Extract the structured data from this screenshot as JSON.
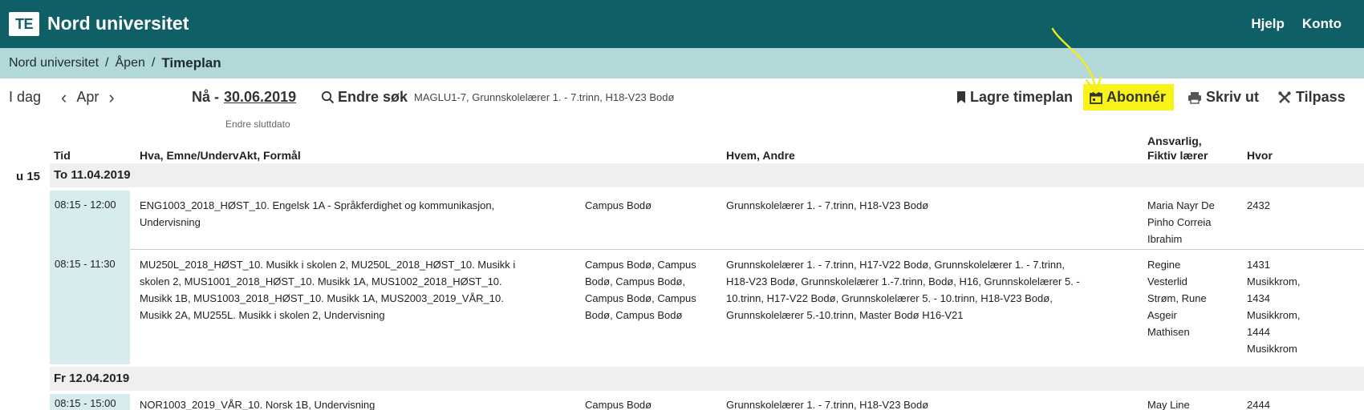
{
  "app": {
    "logo": "TE",
    "title": "Nord universitet",
    "links": [
      "Hjelp",
      "Konto"
    ]
  },
  "breadcrumb": {
    "items": [
      "Nord universitet",
      "Åpen"
    ],
    "separator": "/",
    "current": "Timeplan"
  },
  "toolbar": {
    "today": "I dag",
    "month": "Apr",
    "now_label": "Nå -",
    "end_date": "30.06.2019",
    "end_date_note": "Endre sluttdato",
    "search_label": "Endre søk",
    "search_query": "MAGLU1-7, Grunnskolelærer 1. - 7.trinn, H18-V23 Bodø",
    "actions": {
      "save": "Lagre timeplan",
      "subscribe": "Abonnér",
      "print": "Skriv ut",
      "customize": "Tilpass"
    }
  },
  "table": {
    "headers": {
      "time": "Tid",
      "what": "Hva, Emne/UndervAkt, Formål",
      "who": "Hvem, Andre",
      "responsible_1": "Ansvarlig,",
      "responsible_2": "Fiktiv lærer",
      "where": "Hvor"
    },
    "week": "u 15",
    "days": [
      {
        "label": "To 11.04.2019",
        "rows": [
          {
            "time": "08:15 - 12:00",
            "what": [
              "ENG1003_2018_HØST_10. Engelsk 1A - Språkferdighet og kommunikasjon,",
              "Undervisning"
            ],
            "campus": [
              "Campus Bodø"
            ],
            "who": [
              "Grunnskolelærer 1. - 7.trinn, H18-V23 Bodø"
            ],
            "responsible": [
              "Maria Nayr De",
              "Pinho Correia",
              "Ibrahim"
            ],
            "where": [
              "2432"
            ]
          },
          {
            "time": "08:15 - 11:30",
            "what": [
              "MU250L_2018_HØST_10. Musikk i skolen 2, MU250L_2018_HØST_10. Musikk i",
              "skolen 2, MUS1001_2018_HØST_10. Musikk 1A, MUS1002_2018_HØST_10.",
              "Musikk 1B, MUS1003_2018_HØST_10. Musikk 1A, MUS2003_2019_VÅR_10.",
              "Musikk 2A, MU255L. Musikk i skolen 2, Undervisning"
            ],
            "campus": [
              "Campus Bodø, Campus",
              "Bodø, Campus Bodø,",
              "Campus Bodø, Campus",
              "Bodø, Campus Bodø"
            ],
            "who": [
              "Grunnskolelærer 1. - 7.trinn, H17-V22 Bodø, Grunnskolelærer 1. - 7.trinn,",
              "H18-V23 Bodø, Grunnskolelærer 1.-7.trinn, Bodø, H16, Grunnskolelærer 5. -",
              "10.trinn, H17-V22 Bodø, Grunnskolelærer 5. - 10.trinn, H18-V23 Bodø,",
              "Grunnskolelærer 5.-10.trinn, Master Bodø H16-V21"
            ],
            "responsible": [
              "Regine",
              "Vesterlid",
              "Strøm, Rune",
              "Asgeir",
              "Mathisen"
            ],
            "where": [
              "1431",
              "Musikkrom,",
              "1434",
              "Musikkrom,",
              "1444",
              "Musikkrom"
            ]
          }
        ]
      },
      {
        "label": "Fr 12.04.2019",
        "rows": [
          {
            "time": "08:15 - 15:00",
            "what": [
              "NOR1003_2019_VÅR_10. Norsk 1B, Undervisning"
            ],
            "campus": [
              "Campus Bodø"
            ],
            "who": [
              "Grunnskolelærer 1. - 7.trinn, H18-V23 Bodø"
            ],
            "responsible": [
              "May Line"
            ],
            "where": [
              "2444"
            ]
          }
        ]
      }
    ]
  },
  "colors": {
    "header_bg": "#0f5f67",
    "breadcrumb_bg": "#b3d8d9",
    "highlight": "#f8f41a",
    "time_cell_bg": "#d7ecef",
    "day_row_bg": "#efefef"
  }
}
